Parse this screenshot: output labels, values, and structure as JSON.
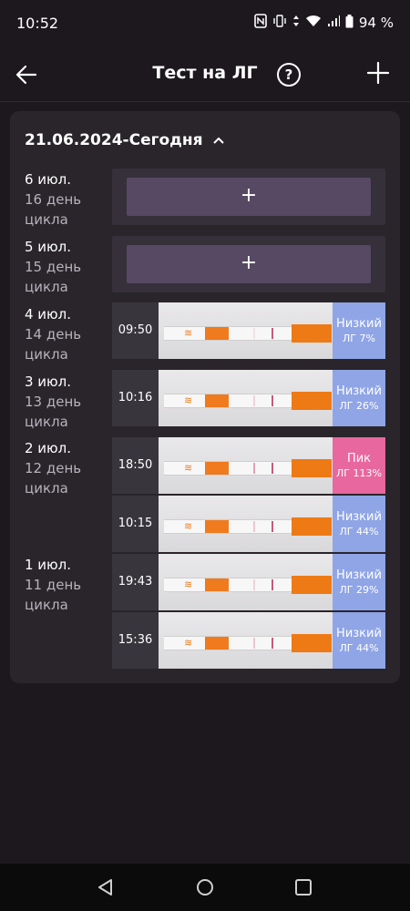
{
  "status_bar": {
    "time": "10:52",
    "battery": "94 %"
  },
  "app_bar": {
    "title": "Тест на ЛГ",
    "help": "?"
  },
  "range": {
    "label": "21.06.2024-Сегодня"
  },
  "days": [
    {
      "date": "6 июл.",
      "cycle": "16 день цикла"
    },
    {
      "date": "5 июл.",
      "cycle": "15 день цикла"
    },
    {
      "date": "4 июл.",
      "cycle": "14 день цикла"
    },
    {
      "date": "3 июл.",
      "cycle": "13 день цикла"
    },
    {
      "date": "2 июл.",
      "cycle": "12 день цикла"
    },
    {
      "date": "1 июл.",
      "cycle": "11 день цикла"
    }
  ],
  "add_label": "+",
  "tests": [
    {
      "time": "09:50",
      "level": "Низкий",
      "percent": "ЛГ 7%",
      "type": "low",
      "line_intensity": 0.07
    },
    {
      "time": "10:16",
      "level": "Низкий",
      "percent": "ЛГ 26%",
      "type": "low",
      "line_intensity": 0.26
    },
    {
      "time": "18:50",
      "level": "Пик",
      "percent": "ЛГ 113%",
      "type": "peak",
      "line_intensity": 1.13
    },
    {
      "time": "10:15",
      "level": "Низкий",
      "percent": "ЛГ 44%",
      "type": "low",
      "line_intensity": 0.44
    },
    {
      "time": "19:43",
      "level": "Низкий",
      "percent": "ЛГ 29%",
      "type": "low",
      "line_intensity": 0.29
    },
    {
      "time": "15:36",
      "level": "Низкий",
      "percent": "ЛГ 44%",
      "type": "low",
      "line_intensity": 0.44
    }
  ],
  "colors": {
    "low": "#8fa5e6",
    "peak": "#e8679e",
    "accent": "#574863"
  },
  "icons": [
    "back-arrow-icon",
    "help-icon",
    "plus-icon",
    "chevron-up-icon",
    "nav-back-icon",
    "nav-home-icon",
    "nav-recents-icon"
  ]
}
